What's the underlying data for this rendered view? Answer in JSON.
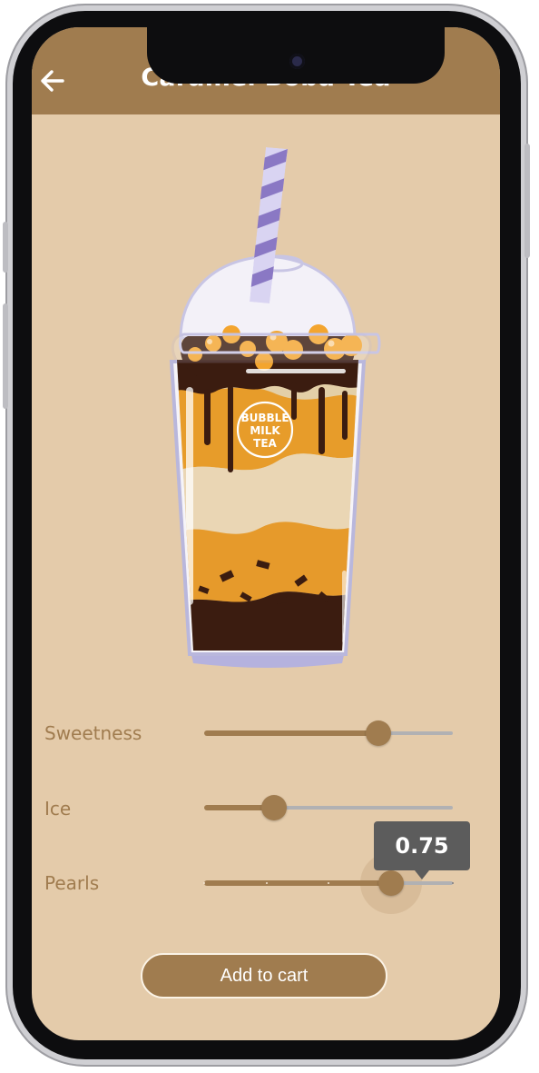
{
  "app": {
    "title": "Caramel Boba Tea"
  },
  "cup": {
    "logo_lines": [
      "BUBBLE",
      "MILK",
      "TEA"
    ]
  },
  "sliders": [
    {
      "label": "Sweetness",
      "value": 0.7
    },
    {
      "label": "Ice",
      "value": 0.28
    },
    {
      "label": "Pearls",
      "value": 0.75,
      "divisions": 4,
      "tooltip": "0.75"
    }
  ],
  "cart_button": {
    "label": "Add to cart"
  },
  "colors": {
    "brand": "#a07c4f",
    "background": "#e4cbaa",
    "track_inactive": "#b1b1b3",
    "tooltip": "#5c5c5c"
  }
}
